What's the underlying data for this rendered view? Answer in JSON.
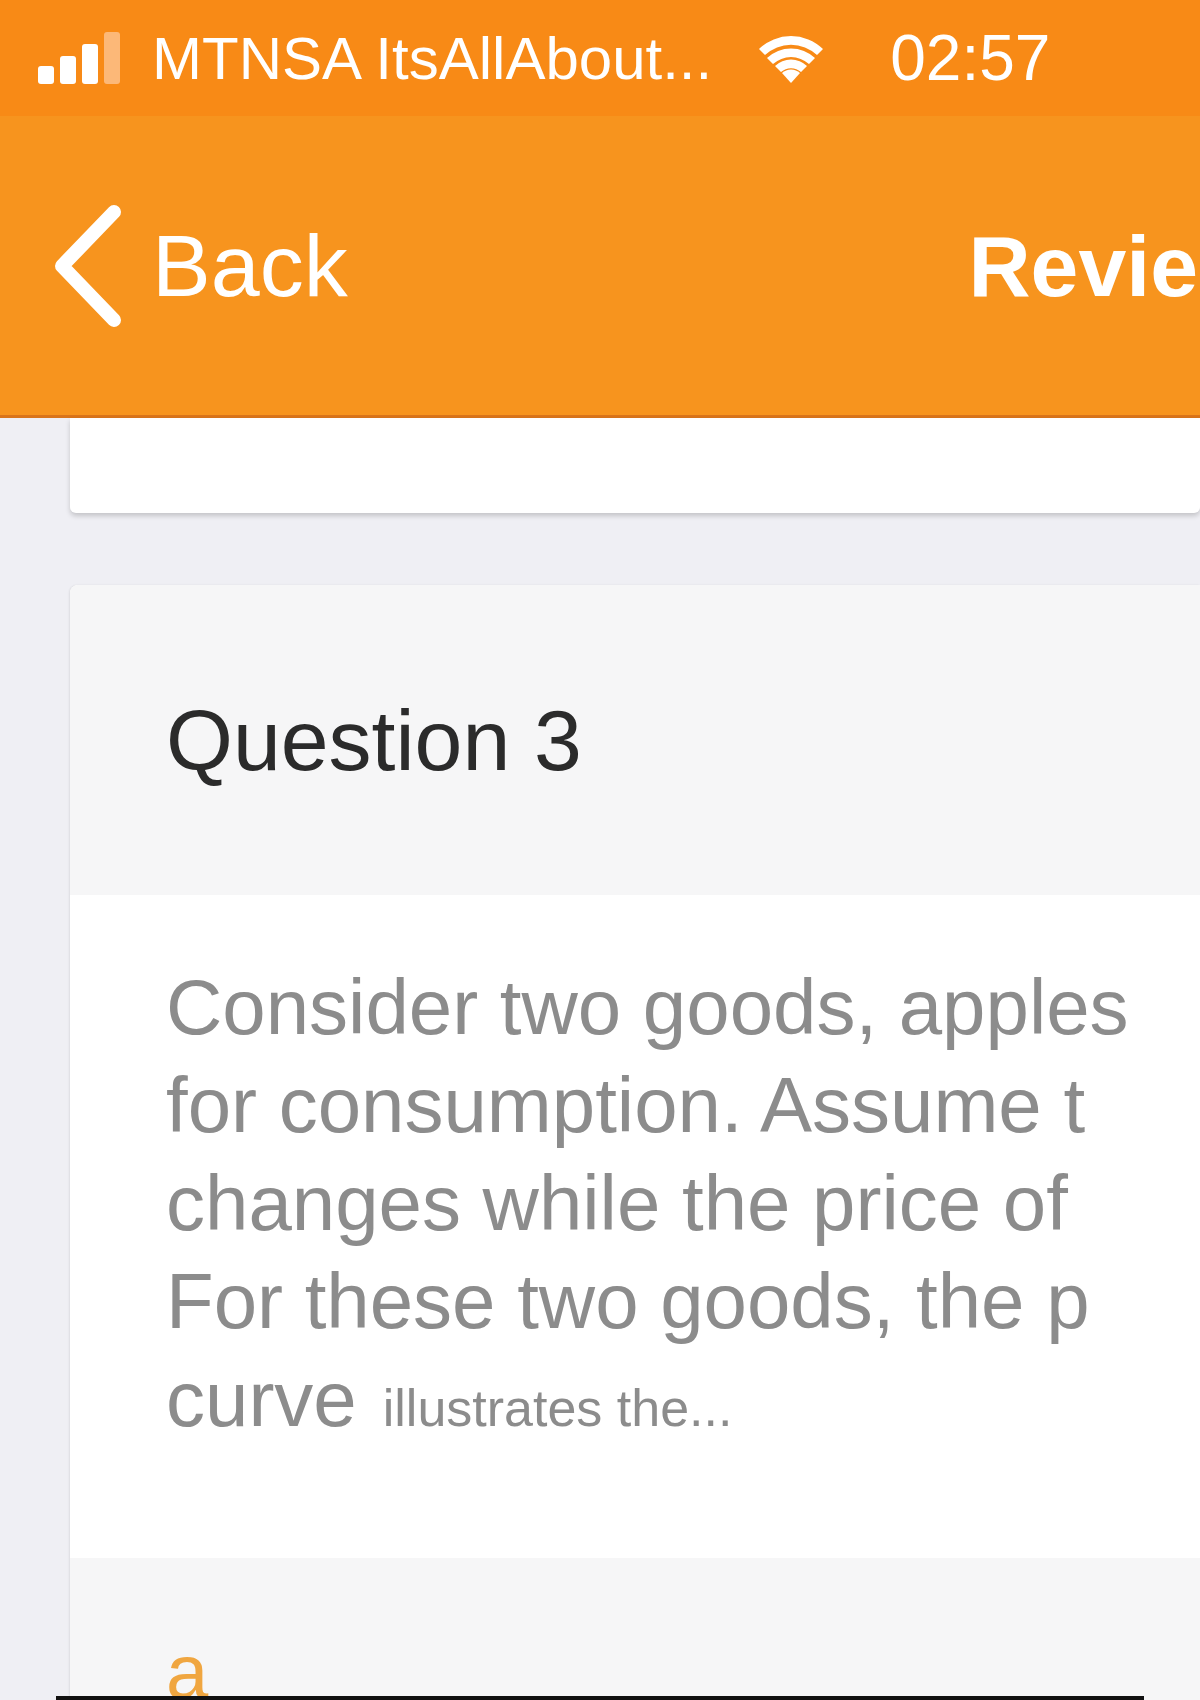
{
  "status_bar": {
    "carrier": "MTNSA ItsAllAbout...",
    "time": "02:57"
  },
  "nav_bar": {
    "back": "Back",
    "title": "Revie"
  },
  "question": {
    "heading": "Question 3",
    "lines": [
      "Consider two goods, apples",
      "for consumption. Assume t",
      "changes while the price of",
      "For these two goods, the p",
      "curve"
    ],
    "tail": "illustrates the...",
    "options": [
      {
        "label": "a"
      }
    ]
  }
}
